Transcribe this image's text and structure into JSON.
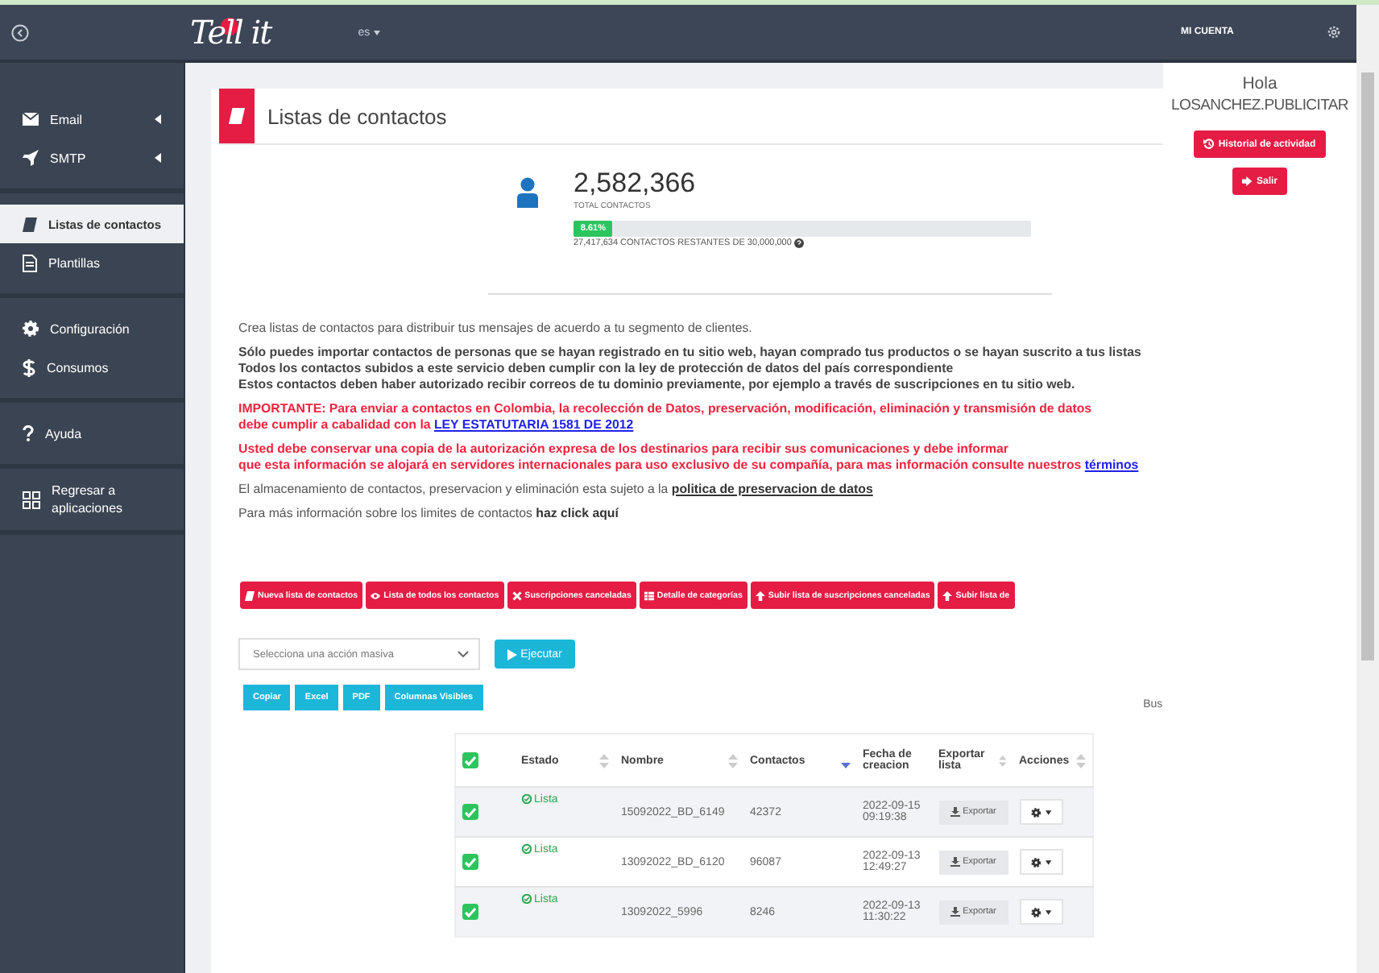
{
  "topbar": {
    "logo": "Tell it",
    "language": "es"
  },
  "sidebar": {
    "groups": [
      {
        "items": [
          {
            "label": "Email",
            "has_submenu": true,
            "selected": false
          },
          {
            "label": "SMTP",
            "has_submenu": true,
            "selected": false
          }
        ]
      },
      {
        "items": [
          {
            "label": "Listas de contactos",
            "has_submenu": false,
            "selected": true
          },
          {
            "label": "Plantillas",
            "has_submenu": false,
            "selected": false
          }
        ]
      },
      {
        "items": [
          {
            "label": "Configuración",
            "has_submenu": false,
            "selected": false
          },
          {
            "label": "Consumos",
            "has_submenu": false,
            "selected": false
          }
        ]
      },
      {
        "items": [
          {
            "label": "Ayuda",
            "has_submenu": false,
            "selected": false
          }
        ]
      },
      {
        "items": [
          {
            "label": "Regresar a aplicaciones",
            "has_submenu": false,
            "selected": false
          }
        ]
      }
    ]
  },
  "page": {
    "title": "Listas de contactos"
  },
  "stats": {
    "total": "2,582,366",
    "total_label": "TOTAL CONTACTOS",
    "usage": {
      "level": 0.0861,
      "label": "8.61%"
    },
    "remaining": "27,417,634 CONTACTOS RESTANTES DE 30,000,000"
  },
  "info": [
    {
      "kind": "normal",
      "lines": [
        "Crea listas de contactos para distribuir tus mensajes de acuerdo a tu segmento de clientes."
      ]
    },
    {
      "kind": "strong",
      "lines": [
        "Sólo puedes importar contactos de personas que se hayan registrado en tu sitio web, hayan comprado tus productos o se hayan suscrito a tus listas",
        "Todos los contactos subidos a este servicio deben cumplir con la ley de protección de datos del país correspondiente",
        "Estos contactos deben haber autorizado recibir correos de tu dominio previamente, por ejemplo a través de suscripciones en tu sitio web."
      ]
    },
    {
      "kind": "alert",
      "lines": [
        "IMPORTANTE: Para enviar a contactos en Colombia, la recolección de Datos, preservación, modificación, eliminación y transmisión de datos",
        "debe cumplir a cabalidad con la "
      ],
      "link": "LEY ESTATUTARIA 1581 DE 2012"
    },
    {
      "kind": "alert",
      "lines": [
        "Usted debe conservar una copia de la autorización expresa de los destinarios para recibir sus comunicaciones y debe informar",
        "que esta información se alojará en servidores internacionales para uso exclusivo de su compañía, para mas información consulte nuestros "
      ],
      "link": "términos"
    },
    {
      "kind": "normal",
      "lines": [
        "El almacenamiento de contactos, preservacion y eliminación esta sujeto a la "
      ],
      "link": "politica de preservacion de datos"
    },
    {
      "kind": "emphasis",
      "lines": [
        "Para más información sobre los limites de contactos "
      ],
      "link": "haz click aquí"
    }
  ],
  "actions": [
    "Nueva lista de contactos",
    "Lista de todos los contactos",
    "Suscripciones canceladas",
    "Detalle de categorías",
    "Subir lista de suscripciones canceladas",
    "Subir lista de"
  ],
  "bulk": {
    "placeholder": "Selecciona una acción masiva",
    "execute": "Ejecutar"
  },
  "exports": [
    "Copiar",
    "Excel",
    "PDF",
    "Columnas Visibles"
  ],
  "search_label": "Bus",
  "table": {
    "header_checked": true,
    "columns": [
      {
        "label": "Estado",
        "sortable": true,
        "sorted_desc": false
      },
      {
        "label": "Nombre",
        "sortable": true,
        "sorted_desc": false
      },
      {
        "label": "Contactos",
        "sortable": true,
        "sorted_desc": true
      },
      {
        "label": "Fecha de creacion",
        "sortable": false,
        "sorted_desc": false
      },
      {
        "label": "Exportar lista",
        "sortable": true,
        "sorted_desc": false
      },
      {
        "label": "Acciones",
        "sortable": true,
        "sorted_desc": false
      }
    ],
    "rows": [
      {
        "checked": true,
        "status": "Lista",
        "name": "15092022_BD_6149",
        "contacts": "42372",
        "created": "2022-09-15 09:19:38",
        "export": "Exportar"
      },
      {
        "checked": true,
        "status": "Lista",
        "name": "13092022_BD_6120",
        "contacts": "96087",
        "created": "2022-09-13 12:49:27",
        "export": "Exportar"
      },
      {
        "checked": true,
        "status": "Lista",
        "name": "13092022_5996",
        "contacts": "8246",
        "created": "2022-09-13 11:30:22",
        "export": "Exportar"
      }
    ]
  },
  "account": {
    "title": "MI CUENTA",
    "greeting": "Hola",
    "user": "LOSANCHEZ.PUBLICITAR",
    "buttons": [
      "Historial de actividad",
      "Salir"
    ]
  }
}
